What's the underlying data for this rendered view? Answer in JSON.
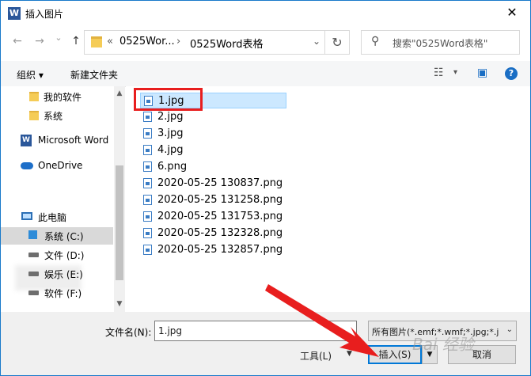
{
  "window": {
    "title": "插入图片",
    "close_glyph": "✕",
    "app_icon_letter": "W"
  },
  "nav": {
    "back": "←",
    "forward": "→",
    "recent": "⌄",
    "up": "↑"
  },
  "address": {
    "prefix": "«",
    "crumbs": [
      "0525Wor...",
      "0525Word表格"
    ],
    "separator": "›",
    "dropdown": "⌄",
    "refresh": "↻"
  },
  "search": {
    "placeholder": "搜索\"0525Word表格\"",
    "icon": "search-icon"
  },
  "toolbar": {
    "organize": "组织 ▾",
    "new_folder": "新建文件夹",
    "view_icon": "☷",
    "view_drop": "▾",
    "pane_icon": "▣",
    "help": "?"
  },
  "sidebar": {
    "items": [
      {
        "label": "我的软件",
        "icon": "folder-icon"
      },
      {
        "label": "系统",
        "icon": "folder-icon"
      },
      {
        "label": "Microsoft Word",
        "icon": "word-icon"
      },
      {
        "label": "OneDrive",
        "icon": "onedrive-icon"
      },
      {
        "label": "此电脑",
        "icon": "computer-icon"
      },
      {
        "label": "系统 (C:)",
        "icon": "windows-drive-icon",
        "selected": true
      },
      {
        "label": "文件 (D:)",
        "icon": "drive-icon"
      },
      {
        "label": "娱乐 (E:)",
        "icon": "drive-icon"
      },
      {
        "label": "软件 (F:)",
        "icon": "drive-icon"
      }
    ],
    "scroll_up": "▲",
    "scroll_down": "▼"
  },
  "files": [
    {
      "name": "1.jpg",
      "selected": true
    },
    {
      "name": "2.jpg"
    },
    {
      "name": "3.jpg"
    },
    {
      "name": "4.jpg"
    },
    {
      "name": "6.png"
    },
    {
      "name": "2020-05-25  130837.png"
    },
    {
      "name": "2020-05-25  131258.png"
    },
    {
      "name": "2020-05-25  131753.png"
    },
    {
      "name": "2020-05-25  132328.png"
    },
    {
      "name": "2020-05-25  132857.png"
    }
  ],
  "footer": {
    "filename_label": "文件名(N):",
    "filename_value": "1.jpg",
    "filter_value": "所有图片(*.emf;*.wmf;*.jpg;*.j",
    "filter_arrow": "⌄",
    "tools_label": "工具(L)",
    "tools_arrow": "▼",
    "insert_label": "插入(S)",
    "insert_drop": "▼",
    "cancel_label": "取消"
  },
  "watermark": "Bai 经验",
  "colors": {
    "accent": "#0078d7",
    "highlight_box": "#e81e1e",
    "selection": "#cce8ff"
  }
}
